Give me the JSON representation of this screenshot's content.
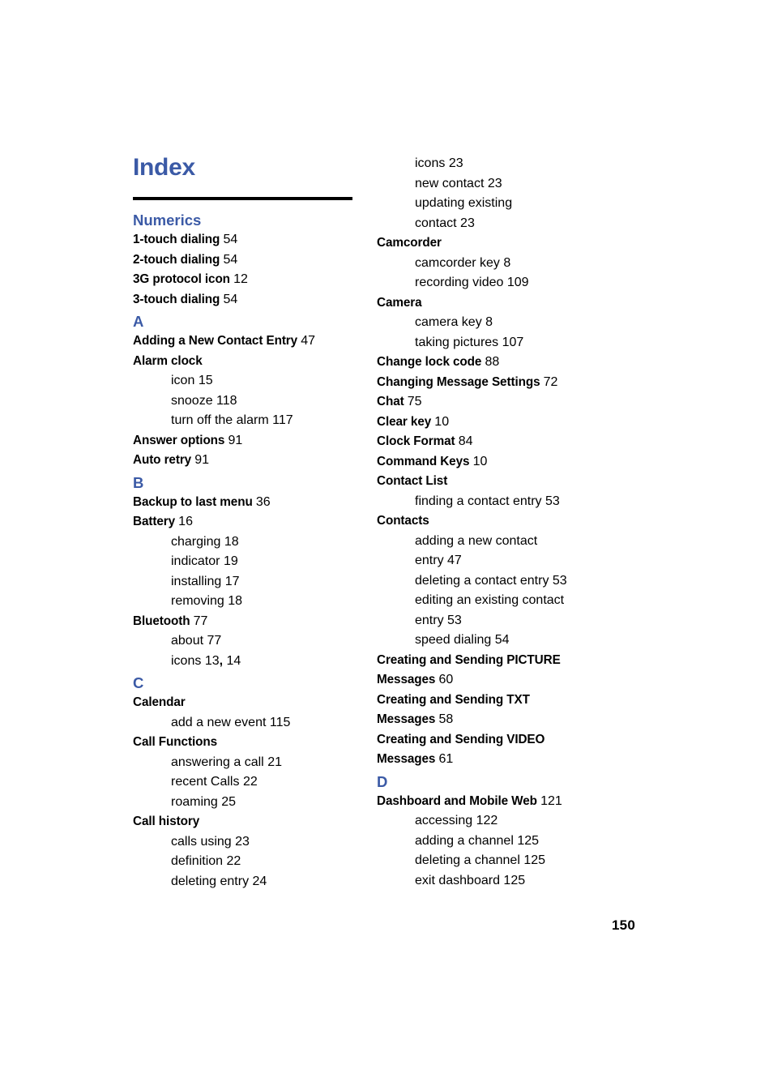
{
  "document": {
    "title": "Index",
    "page_number": "150",
    "accent_color": "#3b5aa6",
    "rule_color": "#000000"
  },
  "left_column": {
    "sections": [
      {
        "heading": "Numerics",
        "entries": [
          {
            "type": "main",
            "term": "1-touch dialing",
            "page": "54"
          },
          {
            "type": "main",
            "term": "2-touch dialing",
            "page": "54"
          },
          {
            "type": "main",
            "term": "3G protocol icon",
            "page": "12"
          },
          {
            "type": "main",
            "term": "3-touch dialing",
            "page": "54"
          }
        ]
      },
      {
        "heading": "A",
        "entries": [
          {
            "type": "main",
            "term": "Adding a New Contact Entry",
            "page": "47"
          },
          {
            "type": "main",
            "term": "Alarm clock",
            "page": ""
          },
          {
            "type": "sub",
            "term": "icon",
            "page": "15"
          },
          {
            "type": "sub",
            "term": "snooze",
            "page": "118"
          },
          {
            "type": "sub",
            "term": "turn off the alarm",
            "page": "117"
          },
          {
            "type": "main",
            "term": "Answer options",
            "page": "91"
          },
          {
            "type": "main",
            "term": "Auto retry",
            "page": "91"
          }
        ]
      },
      {
        "heading": "B",
        "entries": [
          {
            "type": "main",
            "term": "Backup to last menu",
            "page": "36"
          },
          {
            "type": "main",
            "term": "Battery",
            "page": "16"
          },
          {
            "type": "sub",
            "term": "charging",
            "page": "18"
          },
          {
            "type": "sub",
            "term": "indicator",
            "page": "19"
          },
          {
            "type": "sub",
            "term": "installing",
            "page": "17"
          },
          {
            "type": "sub",
            "term": "removing",
            "page": "18"
          },
          {
            "type": "main",
            "term": "Bluetooth",
            "page": "77"
          },
          {
            "type": "sub",
            "term": "about",
            "page": "77"
          },
          {
            "type": "sub",
            "term": "icons",
            "page": "13, 14"
          }
        ]
      },
      {
        "heading": "C",
        "entries": [
          {
            "type": "main",
            "term": "Calendar",
            "page": ""
          },
          {
            "type": "sub",
            "term": "add a new event",
            "page": "115"
          },
          {
            "type": "main",
            "term": "Call Functions",
            "page": ""
          },
          {
            "type": "sub",
            "term": "answering a call",
            "page": "21"
          },
          {
            "type": "sub",
            "term": "recent Calls",
            "page": "22"
          },
          {
            "type": "sub",
            "term": "roaming",
            "page": "25"
          },
          {
            "type": "main",
            "term": "Call history",
            "page": ""
          },
          {
            "type": "sub",
            "term": "calls using",
            "page": "23"
          },
          {
            "type": "sub",
            "term": "definition",
            "page": "22"
          },
          {
            "type": "sub",
            "term": "deleting entry",
            "page": "24"
          }
        ]
      }
    ]
  },
  "right_column": {
    "continued_entries": [
      {
        "type": "sub",
        "term": "icons",
        "page": "23"
      },
      {
        "type": "sub",
        "term": "new contact",
        "page": "23"
      },
      {
        "type": "sub",
        "term": "updating existing",
        "page": ""
      },
      {
        "type": "sub_cont",
        "term": "contact",
        "page": "23"
      }
    ],
    "sections": [
      {
        "heading": "",
        "entries": [
          {
            "type": "main",
            "term": "Camcorder",
            "page": ""
          },
          {
            "type": "sub",
            "term": "camcorder key",
            "page": "8"
          },
          {
            "type": "sub",
            "term": "recording video",
            "page": "109"
          },
          {
            "type": "main",
            "term": "Camera",
            "page": ""
          },
          {
            "type": "sub",
            "term": "camera key",
            "page": "8"
          },
          {
            "type": "sub",
            "term": "taking pictures",
            "page": "107"
          },
          {
            "type": "main",
            "term": "Change lock code",
            "page": "88"
          },
          {
            "type": "main",
            "term": "Changing Message Settings",
            "page": "72"
          },
          {
            "type": "main",
            "term": "Chat",
            "page": "75"
          },
          {
            "type": "main",
            "term": "Clear key",
            "page": "10"
          },
          {
            "type": "main",
            "term": "Clock Format",
            "page": "84"
          },
          {
            "type": "main",
            "term": "Command Keys",
            "page": "10"
          },
          {
            "type": "main",
            "term": "Contact List",
            "page": ""
          },
          {
            "type": "sub",
            "term": "finding a contact entry",
            "page": "53"
          },
          {
            "type": "main",
            "term": "Contacts",
            "page": ""
          },
          {
            "type": "sub",
            "term": "adding a new contact",
            "page": ""
          },
          {
            "type": "sub_cont",
            "term": "entry",
            "page": "47"
          },
          {
            "type": "sub",
            "term": "deleting a contact entry",
            "page": "53"
          },
          {
            "type": "sub",
            "term": "editing an existing contact",
            "page": ""
          },
          {
            "type": "sub_cont",
            "term": "entry",
            "page": "53"
          },
          {
            "type": "sub",
            "term": "speed dialing",
            "page": "54"
          },
          {
            "type": "main",
            "term": "Creating and Sending PICTURE",
            "page": ""
          },
          {
            "type": "main_cont",
            "term": "Messages",
            "page": "60"
          },
          {
            "type": "main",
            "term": "Creating and Sending TXT",
            "page": ""
          },
          {
            "type": "main_cont",
            "term": "Messages",
            "page": "58"
          },
          {
            "type": "main",
            "term": "Creating and Sending VIDEO",
            "page": ""
          },
          {
            "type": "main_cont",
            "term": "Messages",
            "page": "61"
          }
        ]
      },
      {
        "heading": "D",
        "entries": [
          {
            "type": "main",
            "term": "Dashboard and Mobile Web",
            "page": "121"
          },
          {
            "type": "sub",
            "term": "accessing",
            "page": "122"
          },
          {
            "type": "sub",
            "term": "adding a channel",
            "page": "125"
          },
          {
            "type": "sub",
            "term": "deleting a channel",
            "page": "125"
          },
          {
            "type": "sub",
            "term": "exit dashboard",
            "page": "125"
          }
        ]
      }
    ]
  }
}
